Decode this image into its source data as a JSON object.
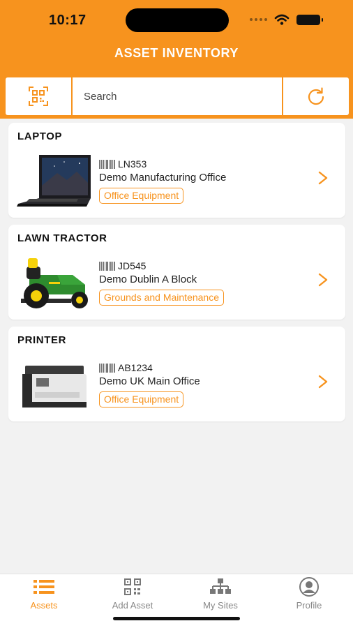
{
  "status_bar": {
    "time": "10:17"
  },
  "header": {
    "title": "ASSET INVENTORY"
  },
  "search": {
    "placeholder": "Search",
    "scan_icon": "qr-scan-icon",
    "refresh_icon": "refresh-icon"
  },
  "assets": [
    {
      "name": "LAPTOP",
      "code": "LN353",
      "site": "Demo Manufacturing Office",
      "category": "Office Equipment"
    },
    {
      "name": "LAWN TRACTOR",
      "code": "JD545",
      "site": "Demo Dublin A Block",
      "category": "Grounds and Maintenance"
    },
    {
      "name": "PRINTER",
      "code": "AB1234",
      "site": "Demo UK Main Office",
      "category": "Office Equipment"
    }
  ],
  "tabs": [
    {
      "label": "Assets",
      "icon": "list-icon",
      "active": true
    },
    {
      "label": "Add Asset",
      "icon": "qr-code-icon",
      "active": false
    },
    {
      "label": "My Sites",
      "icon": "sitemap-icon",
      "active": false
    },
    {
      "label": "Profile",
      "icon": "user-circle-icon",
      "active": false
    }
  ],
  "colors": {
    "accent": "#f7931e",
    "background": "#f2f2f2",
    "inactive": "#888888"
  }
}
